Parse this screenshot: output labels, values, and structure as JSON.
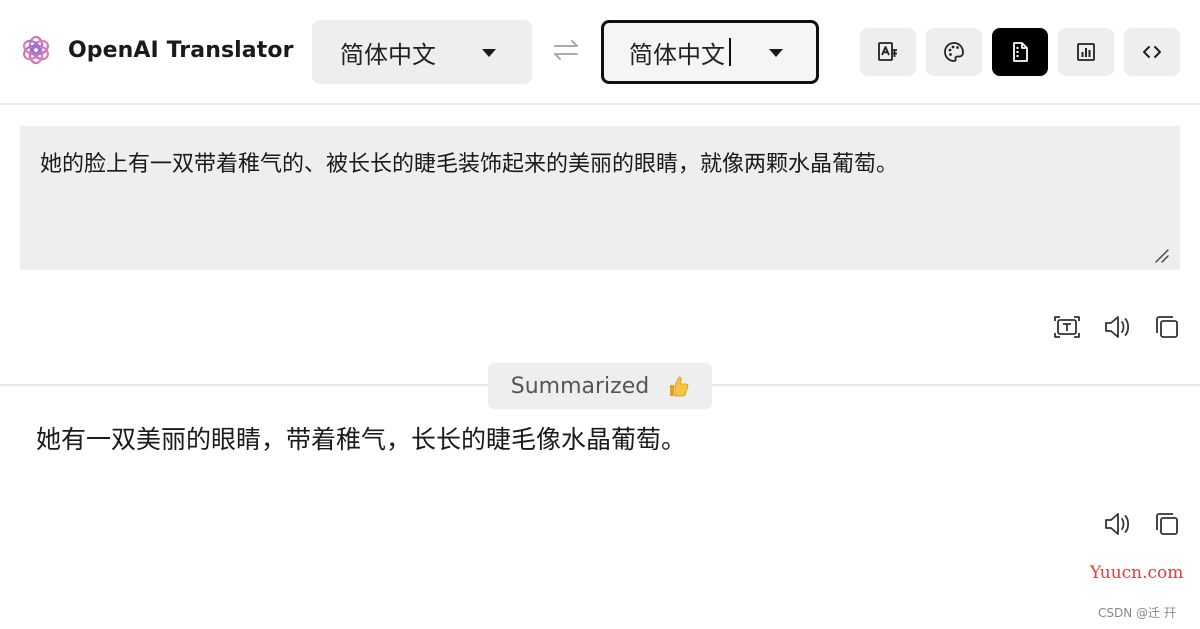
{
  "app": {
    "title": "OpenAI Translator"
  },
  "language": {
    "source": "简体中文",
    "target": "简体中文"
  },
  "toolbar": {
    "buttons": [
      {
        "name": "translate-settings",
        "icon": "translate-icon",
        "active": false
      },
      {
        "name": "theme",
        "icon": "palette-icon",
        "active": false
      },
      {
        "name": "summarize",
        "icon": "document-icon",
        "active": true
      },
      {
        "name": "analyze",
        "icon": "chart-icon",
        "active": false
      },
      {
        "name": "code",
        "icon": "code-brackets-icon",
        "active": false
      }
    ]
  },
  "source": {
    "text": "她的脸上有一双带着稚气的、被长长的睫毛装饰起来的美丽的眼睛，就像两颗水晶葡萄。"
  },
  "mode_badge": {
    "label": "Summarized",
    "emoji": "thumbs-up-icon"
  },
  "result": {
    "text": "她有一双美丽的眼睛，带着稚气，长长的睫毛像水晶葡萄。"
  },
  "watermark": {
    "site": "Yuucn.com",
    "credit": "CSDN @迁  幵"
  },
  "colors": {
    "accent": "#000000",
    "panel": "#eeeeee",
    "watermark": "#e43b3b"
  }
}
